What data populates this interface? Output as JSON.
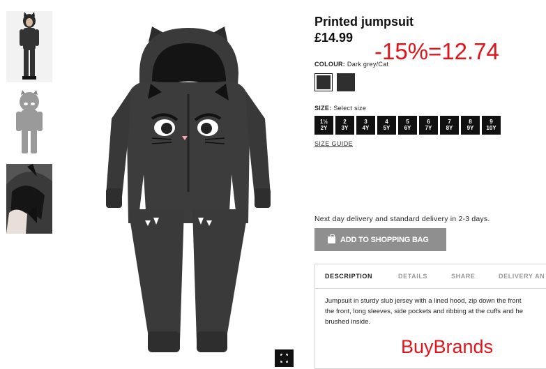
{
  "product": {
    "title": "Printed jumpsuit",
    "price": "£14.99",
    "promo": "-15%=12.74"
  },
  "colour": {
    "label": "COLOUR:",
    "value": "Dark grey/Cat",
    "swatch_color": "#2f2f2f"
  },
  "size": {
    "label": "SIZE:",
    "value": "Select size",
    "options": [
      "1½\n2Y",
      "2\n3Y",
      "3\n4Y",
      "4\n5Y",
      "5\n6Y",
      "6\n7Y",
      "7\n8Y",
      "8\n9Y",
      "9\n10Y"
    ],
    "guide": "SIZE GUIDE"
  },
  "delivery_text": "Next day delivery and standard delivery in 2-3 days.",
  "add_to_bag": "ADD TO SHOPPING BAG",
  "tabs": [
    "DESCRIPTION",
    "DETAILS",
    "SHARE",
    "DELIVERY AN"
  ],
  "description_lines": [
    "Jumpsuit in sturdy slub jersey with a lined hood, zip down the front",
    "the front, long sleeves, side pockets and ribbing at the cuffs and he",
    "brushed inside."
  ],
  "watermark": "BuyBrands",
  "colors": {
    "accent_red": "#e0151b",
    "button_grey": "#8f8f8f",
    "garment": "#3a3a3a"
  }
}
